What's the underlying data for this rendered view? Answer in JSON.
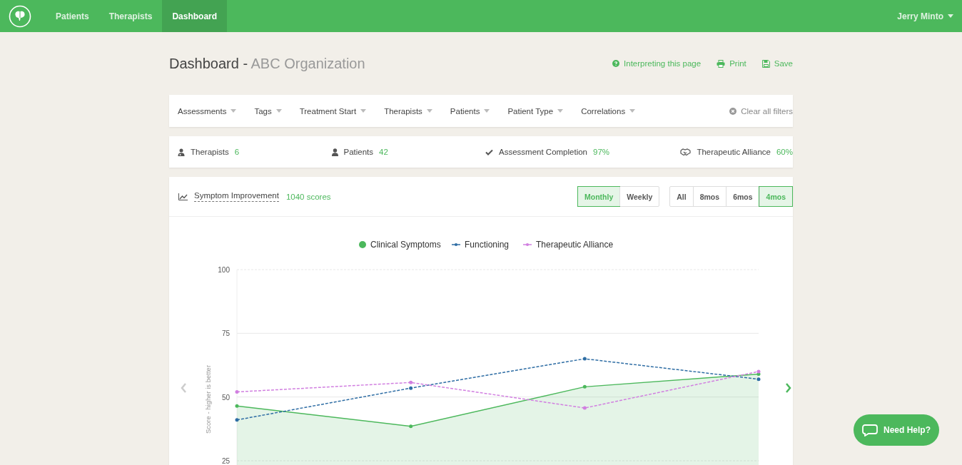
{
  "nav": {
    "items": [
      {
        "label": "Patients",
        "selected": false
      },
      {
        "label": "Therapists",
        "selected": false
      },
      {
        "label": "Dashboard",
        "selected": true
      }
    ],
    "user": "Jerry Minto"
  },
  "header": {
    "title": "Dashboard",
    "separator": "-",
    "organization": "ABC Organization",
    "actions": [
      {
        "kind": "help",
        "label": "Interpreting this page"
      },
      {
        "kind": "print",
        "label": "Print"
      },
      {
        "kind": "save",
        "label": "Save"
      }
    ]
  },
  "filters": {
    "items": [
      "Assessments",
      "Tags",
      "Treatment Start",
      "Therapists",
      "Patients",
      "Patient Type",
      "Correlations"
    ],
    "clear": "Clear all filters"
  },
  "stats": [
    {
      "kind": "therapist",
      "label": "Therapists",
      "value": "6"
    },
    {
      "kind": "patient",
      "label": "Patients",
      "value": "42"
    },
    {
      "kind": "check",
      "label": "Assessment Completion",
      "value": "97%"
    },
    {
      "kind": "alliance",
      "label": "Therapeutic Alliance",
      "value": "60%"
    }
  ],
  "chart_panel": {
    "title": "Symptom Improvement",
    "count": "1040 scores",
    "granularity": [
      {
        "label": "Monthly",
        "selected": true
      },
      {
        "label": "Weekly",
        "selected": false
      }
    ],
    "ranges": [
      {
        "label": "All",
        "selected": false
      },
      {
        "label": "8mos",
        "selected": false
      },
      {
        "label": "6mos",
        "selected": false
      },
      {
        "label": "4mos",
        "selected": true
      }
    ],
    "chart_data": {
      "type": "line",
      "legend": "top",
      "ylabel": "Score - higher is better",
      "ylim": [
        25,
        100
      ],
      "yticks": [
        25,
        50,
        75,
        100
      ],
      "series": [
        {
          "name": "Clinical Symptoms",
          "color": "#4cb85c",
          "type": "area",
          "line_style": "solid",
          "values": [
            46.5,
            38.5,
            54,
            59
          ]
        },
        {
          "name": "Functioning",
          "color": "#2e6da4",
          "type": "line",
          "line_style": "dashed",
          "values": [
            41,
            53.5,
            65,
            57
          ]
        },
        {
          "name": "Therapeutic Alliance",
          "color": "#d17fe0",
          "type": "line",
          "line_style": "dashed",
          "values": [
            52,
            55.7,
            45.7,
            60
          ]
        }
      ]
    }
  },
  "help_button": "Need Help?"
}
